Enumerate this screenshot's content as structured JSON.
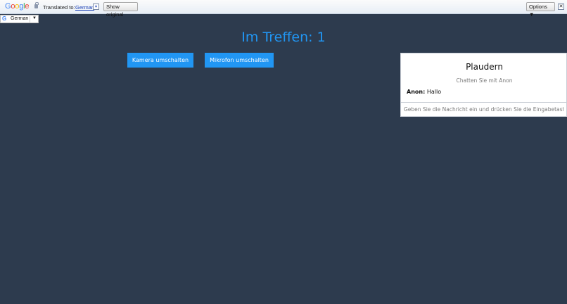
{
  "translate_bar": {
    "logo": "Google",
    "translated_to": "Translated to:",
    "language": "German",
    "show_original": "Show original",
    "options": "Options ▼",
    "close": "✕"
  },
  "language_select": {
    "g": "G",
    "label": "German",
    "caret": "▼"
  },
  "meeting": {
    "title": "Im Treffen: 1",
    "camera_button": "Kamera umschalten",
    "mic_button": "Mikrofon umschalten"
  },
  "chat": {
    "title": "Plaudern",
    "subtitle": "Chatten Sie mit Anon",
    "messages": [
      {
        "author": "Anon:",
        "text": "Hallo"
      }
    ],
    "input_placeholder": "Geben Sie die Nachricht ein und drücken Sie die Eingabetaste"
  },
  "colors": {
    "background": "#2d3b4e",
    "accent": "#2196f3"
  }
}
